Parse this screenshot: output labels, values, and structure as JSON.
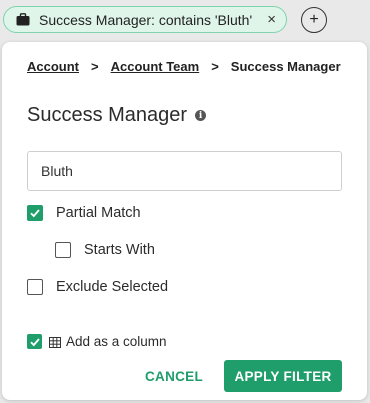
{
  "filter_chip": {
    "label": "Success Manager: contains 'Bluth'",
    "icon": "briefcase-icon",
    "remove": "×"
  },
  "add_filter": {
    "label": "+"
  },
  "breadcrumb": {
    "items": [
      "Account",
      "Account Team",
      "Success Manager"
    ],
    "separator": ">"
  },
  "title": "Success Manager",
  "info_icon": "i",
  "search": {
    "value": "Bluth"
  },
  "options": {
    "partial_match": {
      "label": "Partial Match",
      "checked": true
    },
    "starts_with": {
      "label": "Starts With",
      "checked": false
    },
    "exclude_selected": {
      "label": "Exclude Selected",
      "checked": false
    },
    "add_column": {
      "label": "Add as a column",
      "checked": true
    }
  },
  "actions": {
    "cancel": "CANCEL",
    "apply": "APPLY FILTER"
  },
  "colors": {
    "accent": "#1f9d6b",
    "chip_bg": "#dff5ea",
    "chip_border": "#7fd3ad"
  }
}
